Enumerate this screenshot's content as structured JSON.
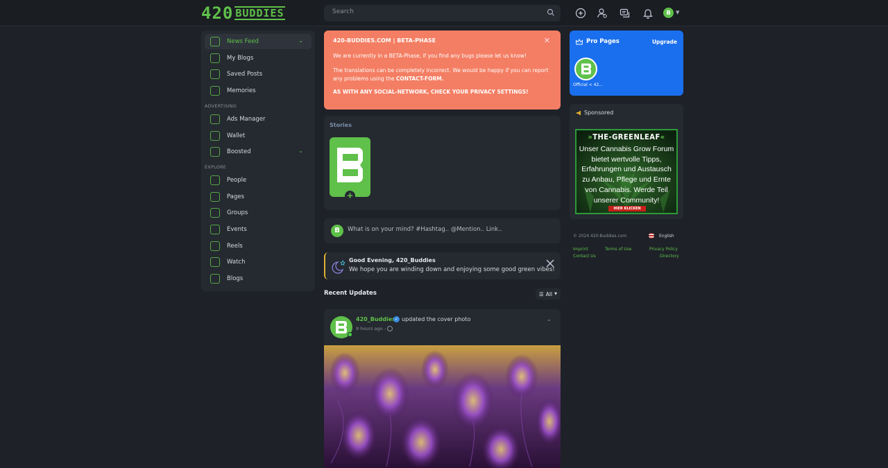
{
  "header": {
    "logo_num": "420",
    "logo_text": "BUDDIES",
    "search_placeholder": "Search",
    "icons": [
      "add-circle-icon",
      "friends-icon",
      "messages-icon",
      "bell-icon",
      "avatar-icon"
    ]
  },
  "sidebar": {
    "items": [
      {
        "label": "News Feed",
        "icon": "news-feed-icon",
        "active": true
      },
      {
        "label": "My Blogs",
        "icon": "blog-icon"
      },
      {
        "label": "Saved Posts",
        "icon": "bookmark-icon"
      },
      {
        "label": "Memories",
        "icon": "memories-icon"
      }
    ],
    "advertising_heading": "ADVERTISING",
    "advertising": [
      {
        "label": "Ads Manager",
        "icon": "megaphone-icon"
      },
      {
        "label": "Wallet",
        "icon": "wallet-icon"
      },
      {
        "label": "Boosted",
        "icon": "boost-icon"
      }
    ],
    "explore_heading": "EXPLORE",
    "explore": [
      {
        "label": "People",
        "icon": "people-icon"
      },
      {
        "label": "Pages",
        "icon": "flag-icon"
      },
      {
        "label": "Groups",
        "icon": "groups-icon"
      },
      {
        "label": "Events",
        "icon": "calendar-icon"
      },
      {
        "label": "Reels",
        "icon": "reels-icon"
      },
      {
        "label": "Watch",
        "icon": "watch-icon"
      },
      {
        "label": "Blogs",
        "icon": "blogs-icon"
      }
    ]
  },
  "beta": {
    "title": "420-BUDDIES.COM | BETA-PHASE",
    "p1": "We are currently in a BETA-Phase, if you find any bugs please let us know!",
    "p2_prefix": "The translations can be completely incorrect. We would be happy if you can report any problems using the ",
    "p2_link": "CONTACT-FORM.",
    "p3": "AS WITH ANY SOCIAL-NETWORK, CHECK YOUR PRIVACY SETTINGS!"
  },
  "stories": {
    "title": "Stories",
    "add": "+"
  },
  "composer": {
    "placeholder": "What is on your mind? #Hashtag.. @Mention.. Link.."
  },
  "greeting": {
    "title": "Good Evening, 420_Buddies",
    "subtitle": "We hope you are winding down and enjoying some good green vibes!"
  },
  "recent": {
    "title": "Recent Updates",
    "filter": "All"
  },
  "post": {
    "author": "420_Buddies",
    "action": "updated the cover photo",
    "time": "9 hours ago -"
  },
  "pro": {
    "title": "Pro Pages",
    "upgrade": "Upgrade",
    "page_name": "Official < 42..."
  },
  "sponsored": {
    "title": "Sponsored",
    "ad_brand": "THE-GREENLEAF",
    "ad_lines": [
      "Unser Cannabis Grow Forum",
      "bietet wertvolle Tipps,",
      "Erfahrungen und Austausch",
      "zu Anbau, Pflege und Ernte",
      "von Cannabis. Werde Teil",
      "unserer Community!"
    ],
    "ad_cta": "HIER KLICKEN"
  },
  "footer": {
    "copyright": "© 2024 420-Buddies.com",
    "language": "English",
    "links": [
      "Imprint",
      "Terms of Use",
      "Privacy Policy",
      "Contact Us",
      "Directory"
    ]
  },
  "colors": {
    "accent": "#5fc04a",
    "beta_bg": "#f47e63",
    "pro_bg": "#1a6fee",
    "page_bg": "#1e2128",
    "card_bg": "#252930"
  }
}
